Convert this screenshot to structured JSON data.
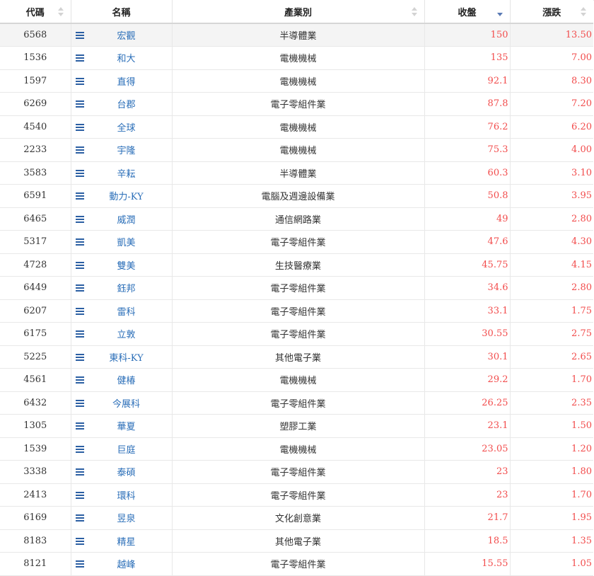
{
  "headers": {
    "code": "代碼",
    "name": "名稱",
    "industry": "產業別",
    "close": "收盤",
    "change": "漲跌"
  },
  "sort_column": "close",
  "sort_direction": "desc",
  "colors": {
    "link": "#2a6eb8",
    "up_value": "#f24c4c",
    "icon": "#2b5fa3",
    "sort_active": "#5a7bb5"
  },
  "row_icon": "list-icon",
  "rows": [
    {
      "code": "6568",
      "name": "宏觀",
      "industry": "半導體業",
      "close": "150",
      "change": "13.50"
    },
    {
      "code": "1536",
      "name": "和大",
      "industry": "電機機械",
      "close": "135",
      "change": "7.00"
    },
    {
      "code": "1597",
      "name": "直得",
      "industry": "電機機械",
      "close": "92.1",
      "change": "8.30"
    },
    {
      "code": "6269",
      "name": "台郡",
      "industry": "電子零組件業",
      "close": "87.8",
      "change": "7.20"
    },
    {
      "code": "4540",
      "name": "全球",
      "industry": "電機機械",
      "close": "76.2",
      "change": "6.20"
    },
    {
      "code": "2233",
      "name": "宇隆",
      "industry": "電機機械",
      "close": "75.3",
      "change": "4.00"
    },
    {
      "code": "3583",
      "name": "辛耘",
      "industry": "半導體業",
      "close": "60.3",
      "change": "3.10"
    },
    {
      "code": "6591",
      "name": "動力-KY",
      "industry": "電腦及週邊設備業",
      "close": "50.8",
      "change": "3.95"
    },
    {
      "code": "6465",
      "name": "威潤",
      "industry": "通信網路業",
      "close": "49",
      "change": "2.80"
    },
    {
      "code": "5317",
      "name": "凱美",
      "industry": "電子零組件業",
      "close": "47.6",
      "change": "4.30"
    },
    {
      "code": "4728",
      "name": "雙美",
      "industry": "生技醫療業",
      "close": "45.75",
      "change": "4.15"
    },
    {
      "code": "6449",
      "name": "鈺邦",
      "industry": "電子零組件業",
      "close": "34.6",
      "change": "2.80"
    },
    {
      "code": "6207",
      "name": "雷科",
      "industry": "電子零組件業",
      "close": "33.1",
      "change": "1.75"
    },
    {
      "code": "6175",
      "name": "立敦",
      "industry": "電子零組件業",
      "close": "30.55",
      "change": "2.75"
    },
    {
      "code": "5225",
      "name": "東科-KY",
      "industry": "其他電子業",
      "close": "30.1",
      "change": "2.65"
    },
    {
      "code": "4561",
      "name": "健椿",
      "industry": "電機機械",
      "close": "29.2",
      "change": "1.70"
    },
    {
      "code": "6432",
      "name": "今展科",
      "industry": "電子零組件業",
      "close": "26.25",
      "change": "2.35"
    },
    {
      "code": "1305",
      "name": "華夏",
      "industry": "塑膠工業",
      "close": "23.1",
      "change": "1.50"
    },
    {
      "code": "1539",
      "name": "巨庭",
      "industry": "電機機械",
      "close": "23.05",
      "change": "1.20"
    },
    {
      "code": "3338",
      "name": "泰碩",
      "industry": "電子零組件業",
      "close": "23",
      "change": "1.80"
    },
    {
      "code": "2413",
      "name": "環科",
      "industry": "電子零組件業",
      "close": "23",
      "change": "1.70"
    },
    {
      "code": "6169",
      "name": "昱泉",
      "industry": "文化創意業",
      "close": "21.7",
      "change": "1.95"
    },
    {
      "code": "8183",
      "name": "精星",
      "industry": "其他電子業",
      "close": "18.5",
      "change": "1.35"
    },
    {
      "code": "8121",
      "name": "越峰",
      "industry": "電子零組件業",
      "close": "15.55",
      "change": "1.05"
    }
  ]
}
